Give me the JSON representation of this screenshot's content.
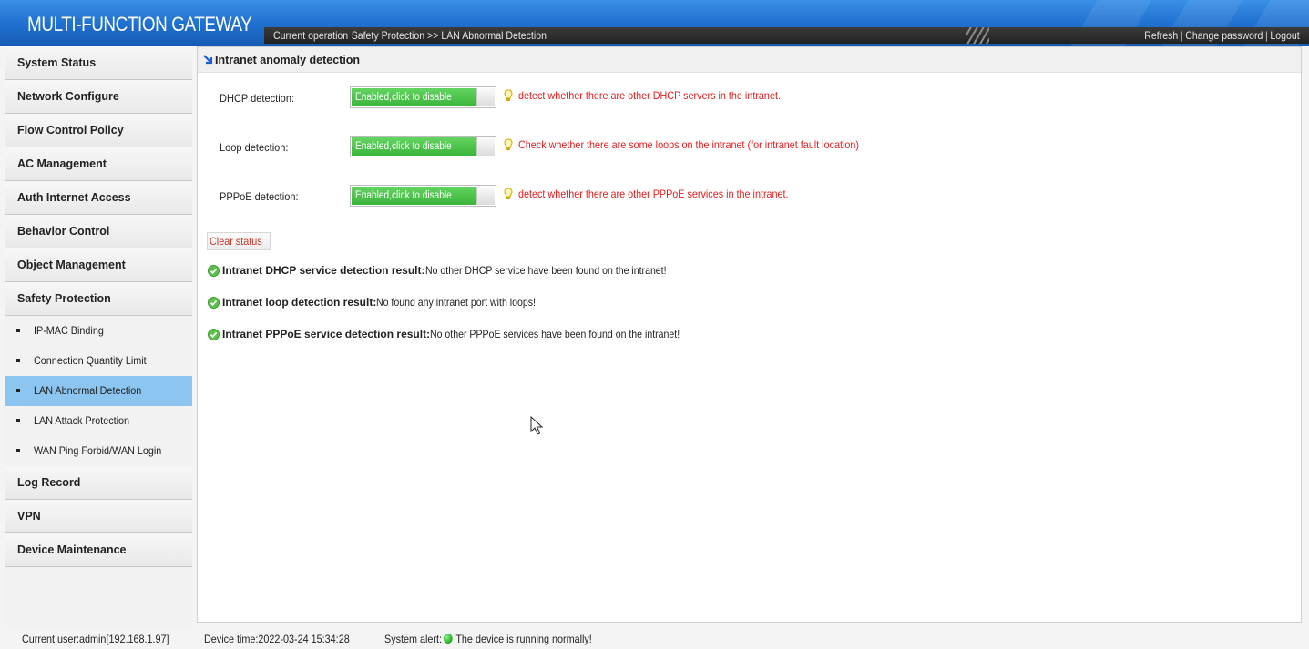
{
  "header": {
    "brand": "MULTI-FUNCTION GATEWAY",
    "current_operation_label": "Current operation",
    "current_operation_path": "Safety Protection >> LAN Abnormal Detection",
    "links": {
      "refresh": "Refresh",
      "change_password": "Change password",
      "logout": "Logout",
      "separator": "|"
    }
  },
  "sidebar": {
    "items": [
      {
        "label": "System Status"
      },
      {
        "label": "Network Configure"
      },
      {
        "label": "Flow Control Policy"
      },
      {
        "label": "AC Management"
      },
      {
        "label": "Auth Internet Access"
      },
      {
        "label": "Behavior Control"
      },
      {
        "label": "Object Management"
      },
      {
        "label": "Safety Protection"
      }
    ],
    "sub_items": [
      {
        "label": "IP-MAC Binding"
      },
      {
        "label": "Connection Quantity Limit"
      },
      {
        "label": "LAN Abnormal Detection"
      },
      {
        "label": "LAN Attack Protection"
      },
      {
        "label": "WAN Ping Forbid/WAN Login"
      }
    ],
    "items_after": [
      {
        "label": "Log Record"
      },
      {
        "label": "VPN"
      },
      {
        "label": "Device Maintenance"
      }
    ]
  },
  "main": {
    "title": "Intranet anomaly detection",
    "detections": [
      {
        "label": "DHCP detection:",
        "toggle": "Enabled,click to disable",
        "hint": "detect whether there are other DHCP servers in the intranet."
      },
      {
        "label": "Loop detection:",
        "toggle": "Enabled,click to disable",
        "hint": "Check whether there are some loops on the intranet (for intranet fault location)"
      },
      {
        "label": "PPPoE detection:",
        "toggle": "Enabled,click to disable",
        "hint": "detect whether there are other PPPoE services in the intranet."
      }
    ],
    "clear_button": "Clear status",
    "results": [
      {
        "label": "Intranet DHCP service detection result:",
        "value": " No other DHCP service have been found on the intranet!"
      },
      {
        "label": "Intranet loop detection result:",
        "value": " No found any intranet port with loops!"
      },
      {
        "label": "Intranet PPPoE service detection result:",
        "value": "No other PPPoE services have been found on the intranet!"
      }
    ]
  },
  "footer": {
    "current_user": "Current user:admin[192.168.1.97]",
    "device_time": "Device time:2022-03-24 15:34:28",
    "system_alert_label": "System alert:",
    "system_alert_text": "The device is running normally!"
  },
  "colors": {
    "header_blue": "#1f6fcf",
    "toggle_green": "#3bb53a",
    "hint_red": "#e02020",
    "active_item": "#8cc5ef"
  }
}
